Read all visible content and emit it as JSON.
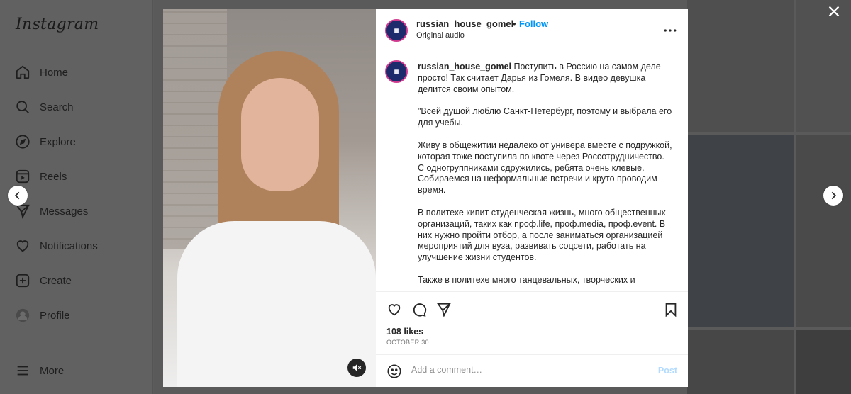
{
  "sidebar": {
    "logo": "Instagram",
    "items": [
      {
        "label": "Home",
        "icon": "home-icon"
      },
      {
        "label": "Search",
        "icon": "search-icon"
      },
      {
        "label": "Explore",
        "icon": "explore-icon"
      },
      {
        "label": "Reels",
        "icon": "reels-icon"
      },
      {
        "label": "Messages",
        "icon": "messages-icon"
      },
      {
        "label": "Notifications",
        "icon": "heart-icon"
      },
      {
        "label": "Create",
        "icon": "create-icon"
      },
      {
        "label": "Profile",
        "icon": "profile-avatar"
      }
    ],
    "more_label": "More"
  },
  "post": {
    "username": "russian_house_gomel",
    "separator": "•",
    "follow_label": "Follow",
    "audio": "Original audio",
    "caption_lead": "Поступить в Россию на самом деле просто! Так считает Дарья из Гомеля. В видео девушка делится своим опытом.",
    "caption_paragraphs": [
      "\"Всей душой люблю Санкт-Петербург, поэтому и выбрала его для учебы.",
      "Живу в общежитии недалеко от универа вместе с подружкой, которая тоже поступила по квоте через Россотрудничество. С одногруппниками сдружились, ребята очень клевые. Собираемся на неформальные встречи и круто проводим время.",
      "В политехе кипит студенческая жизнь, много общественных организаций, таких как проф.life, проф.media, проф.event. В них нужно пройти отбор, а после заниматься организацией мероприятий для вуза, развивать соцсети, работать на улучшение жизни студентов.",
      "Также в политехе много танцевальных, творческих и"
    ],
    "likes": "108 likes",
    "date": "OCTOBER 30",
    "comment_placeholder": "Add a comment…",
    "post_label": "Post"
  },
  "colors": {
    "accent": "#0095f6",
    "post_disabled": "#b3dbff",
    "overlay": "#5c5c5c"
  }
}
